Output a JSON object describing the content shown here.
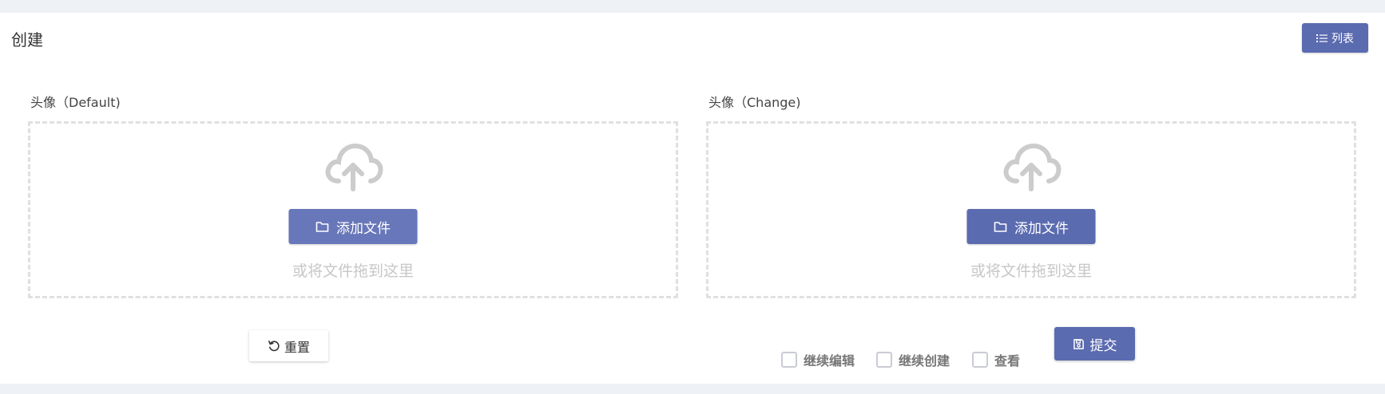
{
  "header": {
    "title": "创建",
    "list_button_label": "列表",
    "list_icon": "list-icon"
  },
  "fields": [
    {
      "label": "头像（Default)",
      "upload_icon": "cloud-upload-icon",
      "add_file_label": "添加文件",
      "add_file_icon": "folder-icon",
      "hint": "或将文件拖到这里"
    },
    {
      "label": "头像（Change)",
      "upload_icon": "cloud-upload-icon",
      "add_file_label": "添加文件",
      "add_file_icon": "folder-icon",
      "hint": "或将文件拖到这里"
    }
  ],
  "footer": {
    "reset_label": "重置",
    "reset_icon": "undo-icon",
    "checkboxes": [
      {
        "label": "继续编辑",
        "checked": false
      },
      {
        "label": "继续创建",
        "checked": false
      },
      {
        "label": "查看",
        "checked": false
      }
    ],
    "submit_label": "提交",
    "submit_icon": "save-icon"
  },
  "colors": {
    "primary": "#5b6bb0",
    "page_bg": "#eef1f5",
    "dropzone_border": "#e0e0e0",
    "hint_text": "#c7c7c7"
  }
}
